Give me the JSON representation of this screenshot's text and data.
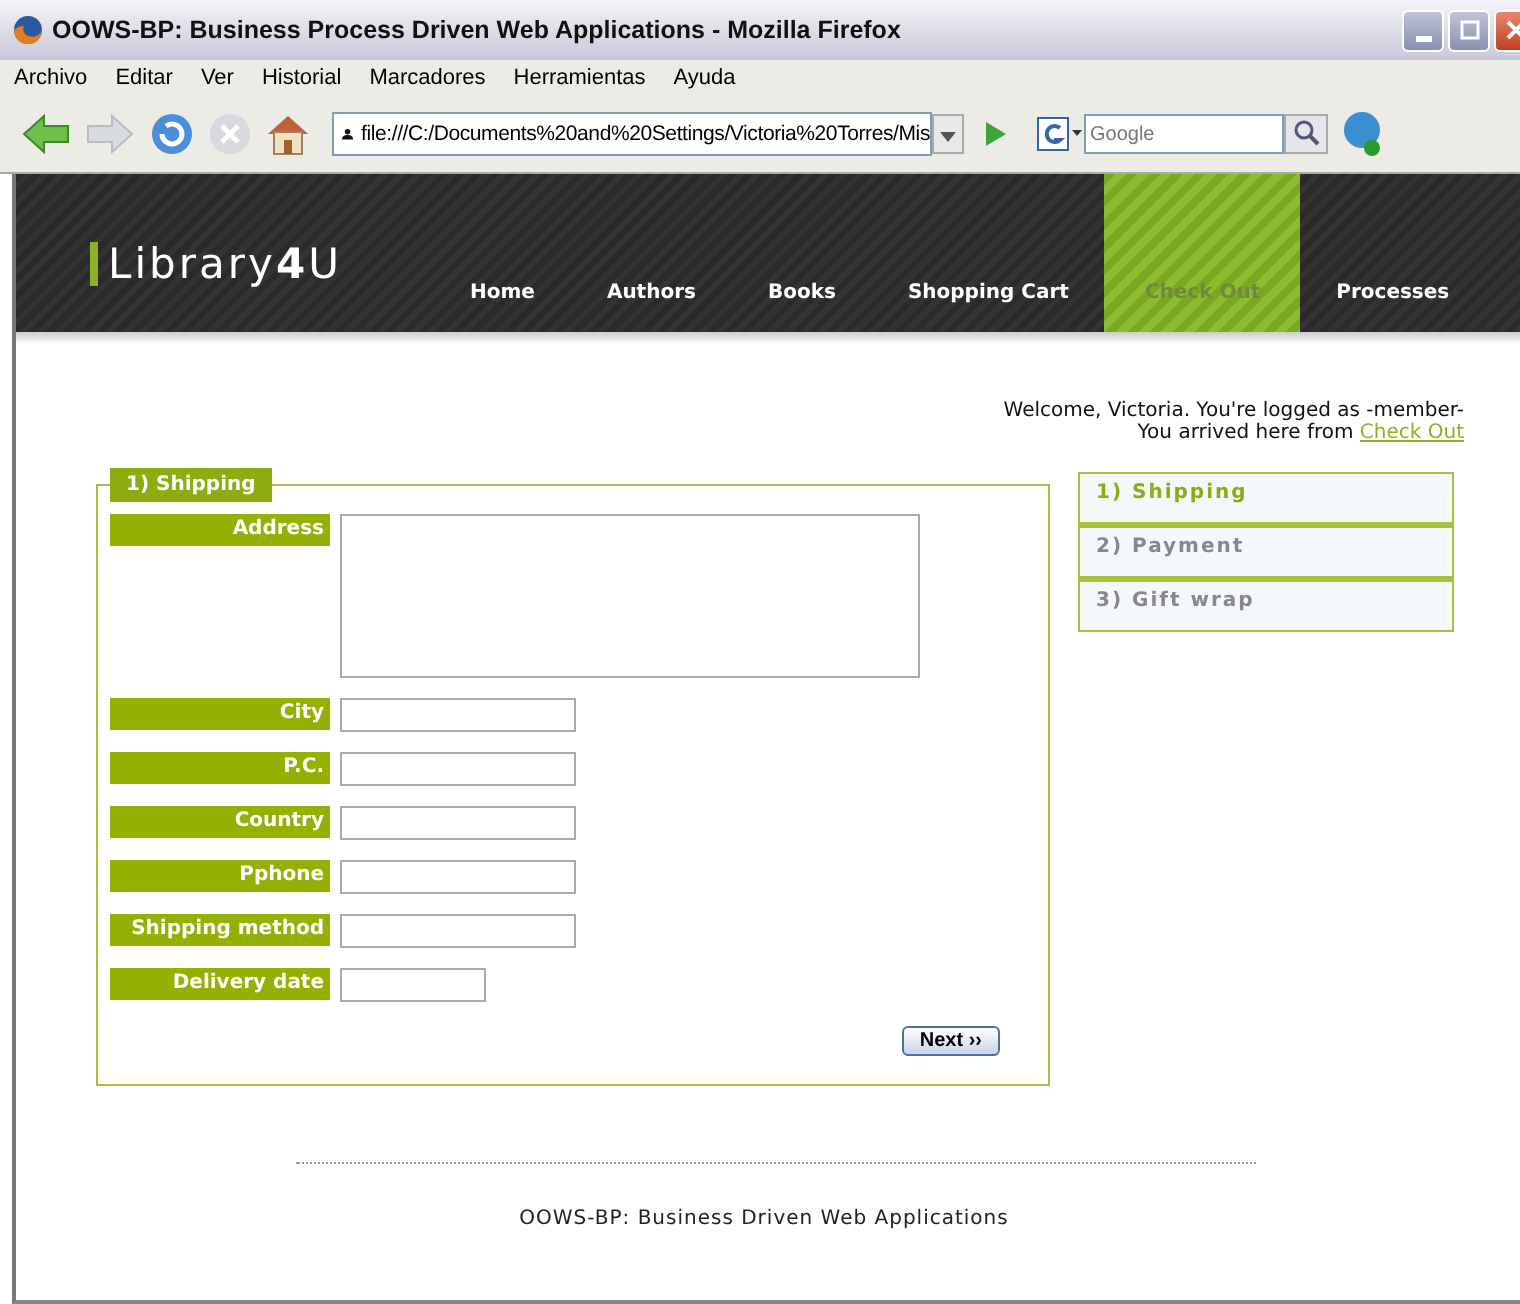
{
  "window": {
    "title": "OOWS-BP: Business Process Driven Web Applications - Mozilla Firefox"
  },
  "menu": [
    "Archivo",
    "Editar",
    "Ver",
    "Historial",
    "Marcadores",
    "Herramientas",
    "Ayuda"
  ],
  "address_bar": {
    "value": "file:///C:/Documents%20and%20Settings/Victoria%20Torres/Mis"
  },
  "search": {
    "placeholder": "Google"
  },
  "logo": "Library**4**U",
  "nav": [
    {
      "label": "Home",
      "selected": false
    },
    {
      "label": "Authors",
      "selected": false
    },
    {
      "label": "Books",
      "selected": false
    },
    {
      "label": "Shopping Cart",
      "selected": false
    },
    {
      "label": "Check Out",
      "selected": true
    },
    {
      "label": "Processes",
      "selected": false
    }
  ],
  "welcome": {
    "line1": "Welcome, Victoria. You're logged as -member-",
    "line2": "You arrived here from",
    "link": "Check Out"
  },
  "form": {
    "legend": "1) Shipping",
    "fields": [
      {
        "label": "Address",
        "kind": "textarea"
      },
      {
        "label": "City",
        "kind": "text"
      },
      {
        "label": "P.C.",
        "kind": "text"
      },
      {
        "label": "Country",
        "kind": "text"
      },
      {
        "label": "Pphone",
        "kind": "text"
      },
      {
        "label": "Shipping method",
        "kind": "text"
      },
      {
        "label": "Delivery date",
        "kind": "short"
      }
    ],
    "button": "Next ››"
  },
  "steps": [
    {
      "label": "1) Shipping",
      "selected": true
    },
    {
      "label": "2) Payment",
      "selected": false
    },
    {
      "label": "3) Gift wrap",
      "selected": false
    }
  ],
  "footer": "OOWS-BP: Business Driven Web Applications"
}
